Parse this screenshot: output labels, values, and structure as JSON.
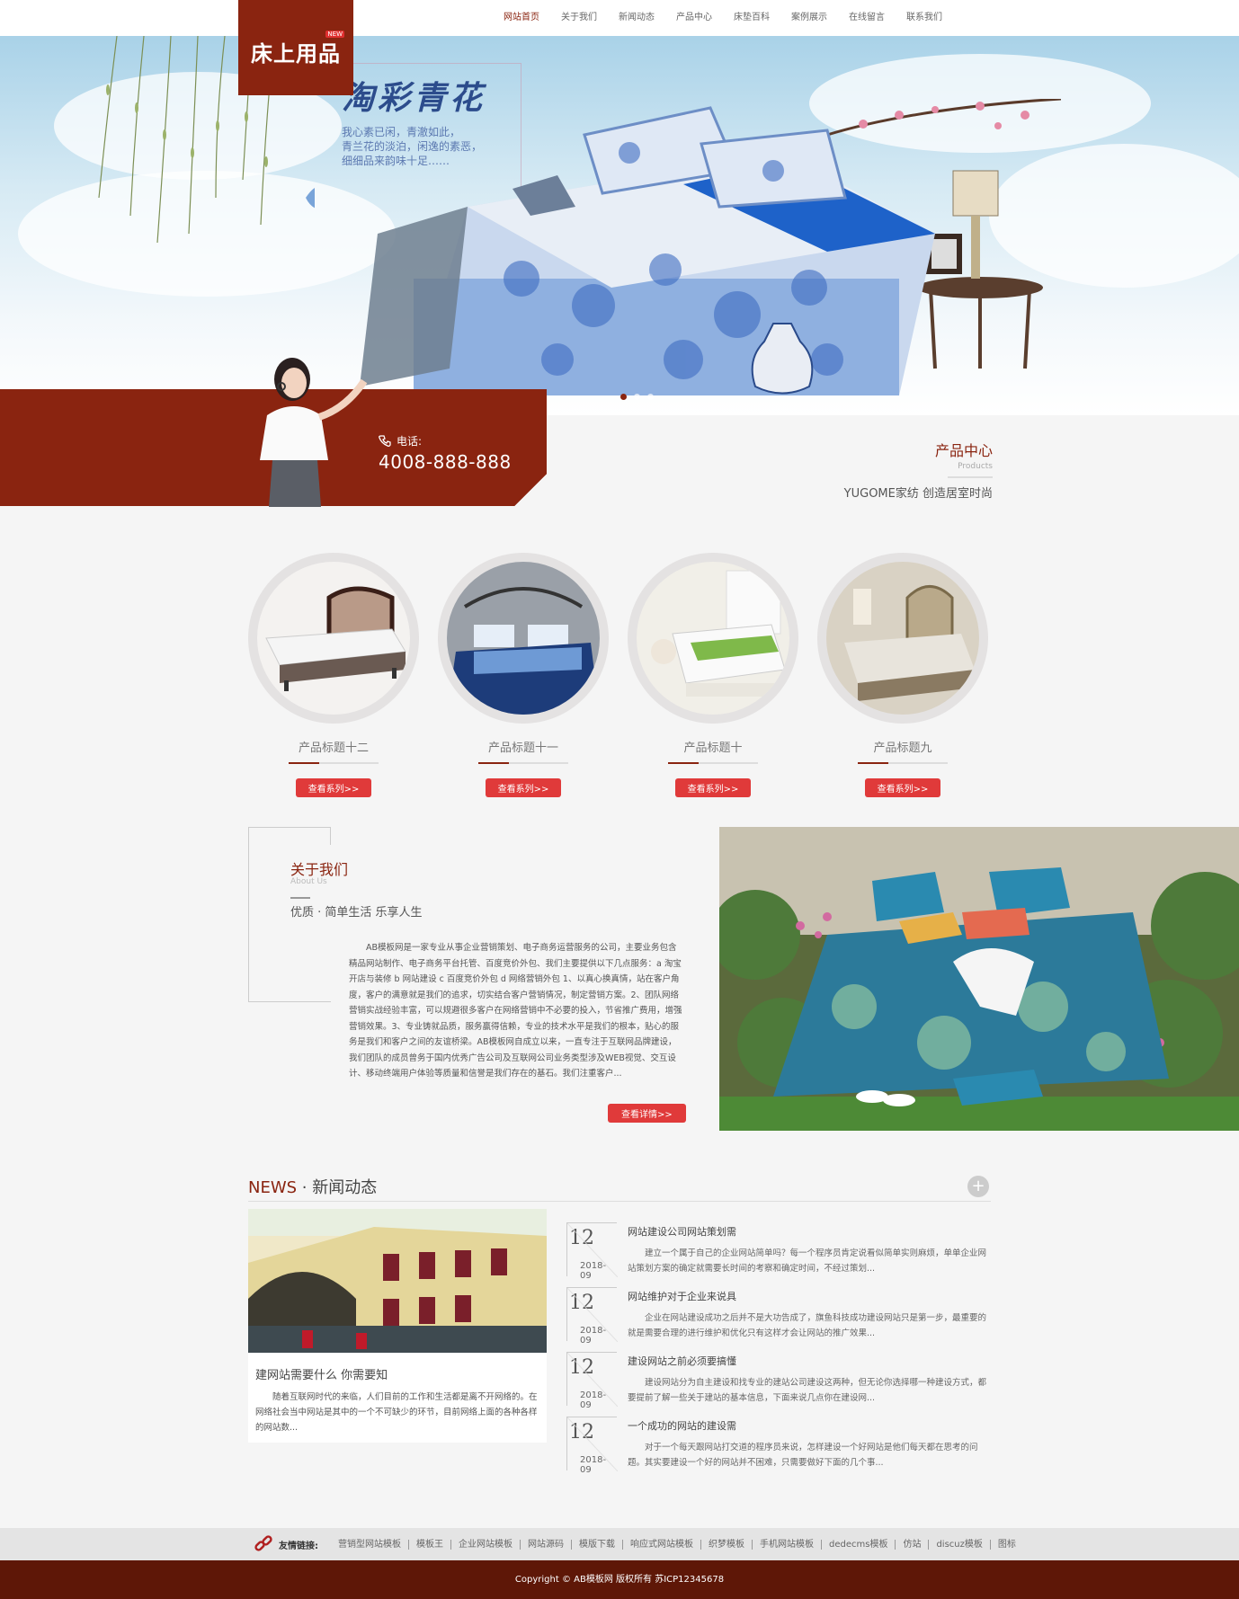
{
  "logo": {
    "text": "床上用品",
    "badge": "NEW"
  },
  "nav": [
    "网站首页",
    "关于我们",
    "新闻动态",
    "产品中心",
    "床垫百科",
    "案例展示",
    "在线留言",
    "联系我们"
  ],
  "banner": {
    "title": "淘彩青花",
    "lines": [
      "我心素已闲，青澈如此，",
      "青兰花的淡泊，闲逸的素恶，",
      "细细品来韵味十足……"
    ]
  },
  "contact": {
    "label": "电话:",
    "phone": "4008-888-888"
  },
  "products_heading": {
    "title": "产品中心",
    "subtitle": "Products",
    "slogan": "YUGOME家纺 创造居室时尚"
  },
  "products": [
    {
      "title": "产品标题十二",
      "button": "查看系列>>"
    },
    {
      "title": "产品标题十一",
      "button": "查看系列>>"
    },
    {
      "title": "产品标题十",
      "button": "查看系列>>"
    },
    {
      "title": "产品标题九",
      "button": "查看系列>>"
    }
  ],
  "about": {
    "title": "关于我们",
    "subtitle": "About Us",
    "slogan": "优质 · 简单生活 乐享人生",
    "text": "AB模板网是一家专业从事企业营销策划、电子商务运营服务的公司，主要业务包含精品网站制作、电子商务平台托管、百度竞价外包、我们主要提供以下几点服务：a 淘宝开店与装修 b 网站建设 c 百度竞价外包 d 网络营销外包 1、以真心换真情，站在客户角度，客户的满意就是我们的追求，切实结合客户营销情况，制定营销方案。2、团队网络营销实战经验丰富，可以规避很多客户在网络营销中不必要的投入，节省推广费用，增强营销效果。3、专业铸就品质，服务赢得信赖，专业的技术水平是我们的根本，贴心的服务是我们和客户之间的友谊桥梁。AB模板网自成立以来，一直专注于互联网品牌建设，我们团队的成员曾务于国内优秀广告公司及互联网公司业务类型涉及WEB视觉、交互设计、移动终端用户体验等质量和信誉是我们存在的基石。我们注重客户...",
    "button": "查看详情>>"
  },
  "news": {
    "title_en": "NEWS",
    "title_cn": " · 新闻动态",
    "more": "+",
    "feature": {
      "title": "建网站需要什么 你需要知",
      "text": "随着互联网时代的来临，人们目前的工作和生活都是离不开网络的。在网络社会当中网站是其中的一个不可缺少的环节，目前网络上面的各种各样的网站数..."
    },
    "items": [
      {
        "day": "12",
        "ym": "2018-09",
        "title": "网站建设公司网站策划需",
        "desc": "建立一个属于自己的企业网站简单吗？每一个程序员肯定说看似简单实则麻烦，单单企业网站策划方案的确定就需要长时间的考察和确定时间，不经过策划..."
      },
      {
        "day": "12",
        "ym": "2018-09",
        "title": "网站维护对于企业来说具",
        "desc": "企业在网站建设成功之后并不是大功告成了，旗鱼科技成功建设网站只是第一步，最重要的就是需要合理的进行维护和优化只有这样才会让网站的推广效果..."
      },
      {
        "day": "12",
        "ym": "2018-09",
        "title": "建设网站之前必须要搞懂",
        "desc": "建设网站分为自主建设和找专业的建站公司建设这两种，但无论你选择哪一种建设方式，都要提前了解一些关于建站的基本信息，下面来说几点你在建设网..."
      },
      {
        "day": "12",
        "ym": "2018-09",
        "title": "一个成功的网站的建设需",
        "desc": "对于一个每天跟网站打交道的程序员来说，怎样建设一个好网站是他们每天都在思考的问题。其实要建设一个好的网站并不困难，只需要做好下面的几个事..."
      }
    ]
  },
  "friend_links": {
    "label": "友情链接:",
    "items": [
      "营销型网站模板",
      "模板王",
      "企业网站模板",
      "网站源码",
      "模版下载",
      "响应式网站模板",
      "织梦模板",
      "手机网站模板",
      "dedecms模板",
      "仿站",
      "discuz模板",
      "图标"
    ]
  },
  "copyright": "Copyright © AB模板网 版权所有 苏ICP12345678",
  "colors": {
    "brand": "#8a2410",
    "footer": "#5e1707",
    "button": "#e03a3a"
  }
}
